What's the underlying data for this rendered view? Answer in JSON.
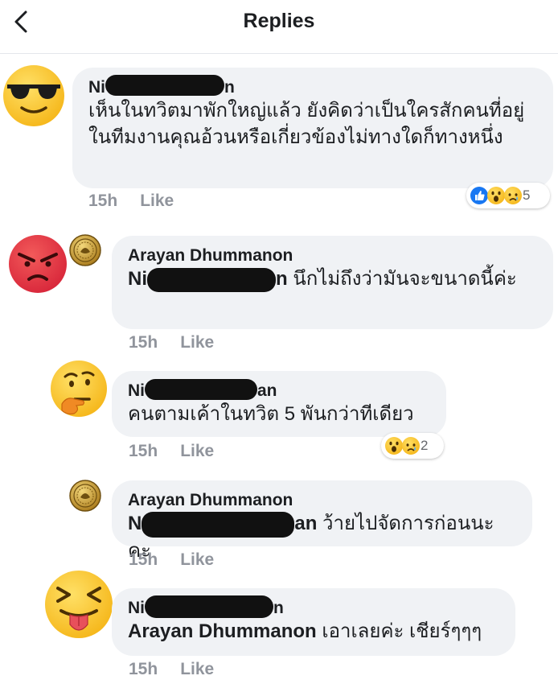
{
  "header": {
    "title": "Replies",
    "back_icon": "chevron-left-icon"
  },
  "comments": [
    {
      "author_visible": [
        "Ni",
        "n"
      ],
      "text": "เห็นในทวิตมาพักใหญ่แล้ว ยังคิดว่าเป็นใครสักคนที่อยู่ในทีมงานคุณอ้วนหรือเกี่ยวข้องไม่ทางใดก็ทางหนึ่ง",
      "time": "15h",
      "like": "Like",
      "avatar": "sunglasses-emoji-icon",
      "reactions": {
        "icons": [
          "like-reaction-icon",
          "wow-reaction-icon",
          "sad-reaction-icon"
        ],
        "count": "5"
      }
    },
    {
      "author": "Arayan Dhummanon",
      "mention_visible": [
        "Ni",
        "n"
      ],
      "text": "นึกไม่ถึงว่ามันจะขนาดนี้ค่ะ",
      "time": "15h",
      "like": "Like",
      "avatar": "angry-emoji-icon",
      "badge": "gold-coin-icon"
    },
    {
      "author_visible": [
        "Ni",
        "an"
      ],
      "text": "คนตามเค้าในทวิต 5 พันกว่าทีเดียว",
      "time": "15h",
      "like": "Like",
      "avatar": "thinking-emoji-icon",
      "reactions": {
        "icons": [
          "wow-reaction-icon",
          "sad-reaction-icon"
        ],
        "count": "2"
      }
    },
    {
      "author": "Arayan Dhummanon",
      "mention_visible": [
        "N",
        "an"
      ],
      "text": "ว้ายไปจัดการก่อนนะคะ",
      "time": "15h",
      "like": "Like",
      "avatar": "gold-coin-icon"
    },
    {
      "author_visible": [
        "Ni",
        "n"
      ],
      "mention": "Arayan Dhummanon",
      "text": "เอาเลยค่ะ เชียร์ๆๆๆ",
      "time": "15h",
      "like": "Like",
      "avatar": "tongue-out-emoji-icon"
    }
  ],
  "colors": {
    "bubble": "#f0f2f5",
    "meta": "#90949c",
    "like_blue": "#1877f2",
    "redaction": "#111111"
  }
}
